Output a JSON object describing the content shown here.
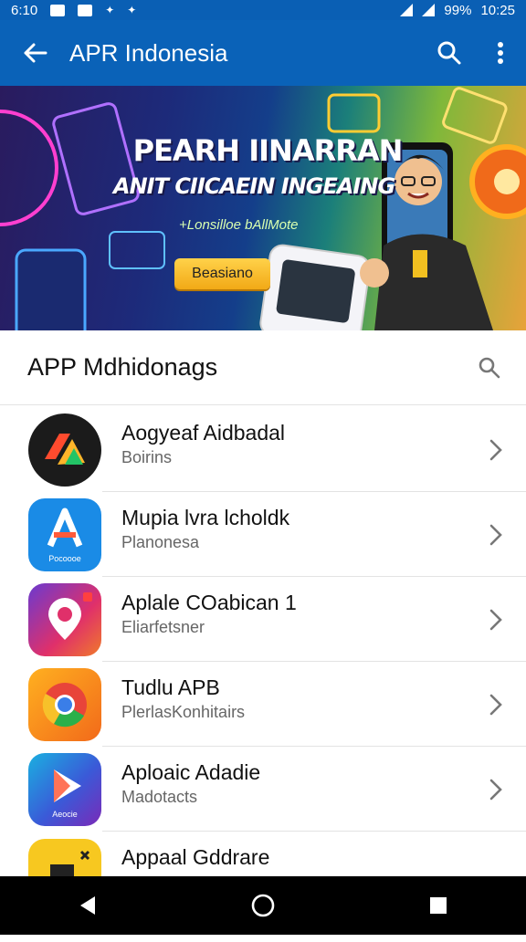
{
  "status_bar": {
    "time": "6:10",
    "battery": "99%",
    "clock": "10:25"
  },
  "app_bar": {
    "title": "APR Indonesia"
  },
  "banner": {
    "headline1": "PEARH IINARRAN",
    "headline2": "ANIT CIICAEIN INGEAING",
    "tagline": "+Lonsilloe bAllMote",
    "cta": "Beasiano"
  },
  "list": {
    "title": "APP Mdhidonags",
    "items": [
      {
        "name": "Aogyeaf Aidbadal",
        "sub": "Boirins"
      },
      {
        "name": "Mupia lvra lcholdk",
        "sub": "Planonesa",
        "icon_caption": "Pocoooe"
      },
      {
        "name": "Aplale COabican 1",
        "sub": "Eliarfetsner"
      },
      {
        "name": "Tudlu APB",
        "sub": "PlerlasKonhitairs"
      },
      {
        "name": "Aploaic Adadie",
        "sub": "Madotacts",
        "icon_caption": "Aeocie"
      },
      {
        "name": "Appaal Gddrare",
        "sub": ""
      }
    ]
  },
  "colors": {
    "app_bar": "#0a62b8",
    "status_bar": "#0a5fb4",
    "cta": "#f2a916"
  }
}
